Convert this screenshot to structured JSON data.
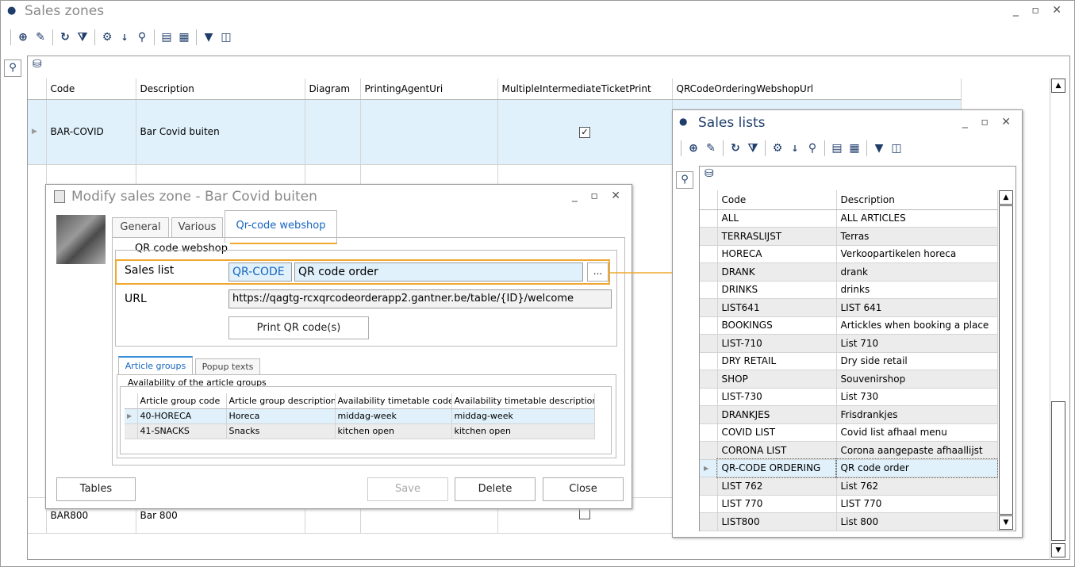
{
  "main": {
    "title": "Sales zones",
    "columns": [
      "Code",
      "Description",
      "Diagram",
      "PrintingAgentUri",
      "MultipleIntermediateTicketPrint",
      "QRCodeOrderingWebshopUrl"
    ],
    "rows": [
      {
        "code": "BAR-COVID",
        "description": "Bar Covid buiten",
        "checked": true
      },
      {
        "code": "BAR800",
        "description": "Bar 800",
        "checked": false
      }
    ]
  },
  "modify": {
    "title": "Modify sales zone - Bar Covid buiten",
    "tabs": [
      "General",
      "Various",
      "Qr-code webshop"
    ],
    "group_title": "QR code webshop",
    "sales_list_label": "Sales list",
    "sales_list_code": "QR-CODE",
    "sales_list_value": "QR code order",
    "browse_label": "...",
    "url_label": "URL",
    "url_value": "https://qagtg-rcxqrcodeorderapp2.gantner.be/table/{ID}/welcome",
    "print_button": "Print QR code(s)",
    "subtabs": [
      "Article groups",
      "Popup texts"
    ],
    "avail_title": "Availability of the article groups",
    "avail_columns": [
      "Article group code",
      "Article group description",
      "Availability timetable code",
      "Availability timetable description"
    ],
    "avail_rows": [
      [
        "40-HORECA",
        "Horeca",
        "middag-week",
        "middag-week"
      ],
      [
        "41-SNACKS",
        "Snacks",
        "kitchen open",
        "kitchen open"
      ]
    ],
    "buttons": {
      "tables": "Tables",
      "save": "Save",
      "delete": "Delete",
      "close": "Close"
    }
  },
  "sales_lists": {
    "title": "Sales lists",
    "columns": [
      "Code",
      "Description"
    ],
    "rows": [
      [
        "ALL",
        "ALL ARTICLES"
      ],
      [
        "TERRASLIJST",
        "Terras"
      ],
      [
        "HORECA",
        "Verkoopartikelen horeca"
      ],
      [
        "DRANK",
        "drank"
      ],
      [
        "DRINKS",
        "drinks"
      ],
      [
        "LIST641",
        "LIST 641"
      ],
      [
        "BOOKINGS",
        "Artickles when booking a place"
      ],
      [
        "LIST-710",
        "List 710"
      ],
      [
        "DRY RETAIL",
        "Dry side retail"
      ],
      [
        "SHOP",
        "Souvenirshop"
      ],
      [
        "LIST-730",
        "List 730"
      ],
      [
        "DRANKJES",
        "Frisdrankjes"
      ],
      [
        "COVID LIST",
        "Covid list afhaal menu"
      ],
      [
        "CORONA LIST",
        "Corona aangepaste afhaallijst"
      ],
      [
        "QR-CODE ORDERING",
        "QR code order"
      ],
      [
        "LIST 762",
        "List 762"
      ],
      [
        "LIST 770",
        "LIST 770"
      ],
      [
        "LIST800",
        "List 800"
      ]
    ],
    "selected_index": 14
  },
  "colors": {
    "accent": "#f0a830",
    "selection": "#e0f1fb",
    "link_blue": "#1565c0"
  }
}
